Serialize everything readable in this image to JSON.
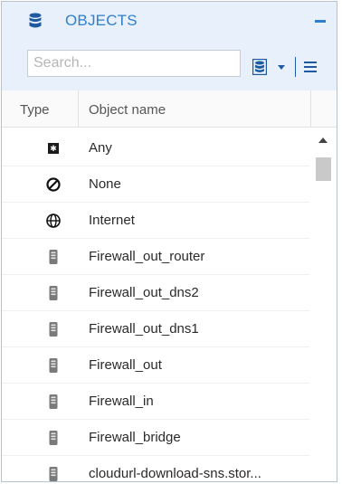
{
  "panel": {
    "title": "OBJECTS",
    "accent_color": "#2f7fd0",
    "header_icon": "database-icon",
    "collapse_icon": "minus-icon"
  },
  "toolbar": {
    "search_placeholder": "Search...",
    "search_value": "",
    "filter_icon": "database-filter-icon",
    "dropdown_icon": "caret-down-icon",
    "menu_icon": "hamburger-menu-icon"
  },
  "grid": {
    "columns": [
      "Type",
      "Object name"
    ],
    "rows": [
      {
        "icon": "any-icon",
        "name": "Any"
      },
      {
        "icon": "none-icon",
        "name": "None"
      },
      {
        "icon": "globe-icon",
        "name": "Internet"
      },
      {
        "icon": "host-icon",
        "name": "Firewall_out_router"
      },
      {
        "icon": "host-icon",
        "name": "Firewall_out_dns2"
      },
      {
        "icon": "host-icon",
        "name": "Firewall_out_dns1"
      },
      {
        "icon": "host-icon",
        "name": "Firewall_out"
      },
      {
        "icon": "host-icon",
        "name": "Firewall_in"
      },
      {
        "icon": "host-icon",
        "name": "Firewall_bridge"
      },
      {
        "icon": "host-icon",
        "name": "cloudurl-download-sns.stor..."
      }
    ]
  }
}
